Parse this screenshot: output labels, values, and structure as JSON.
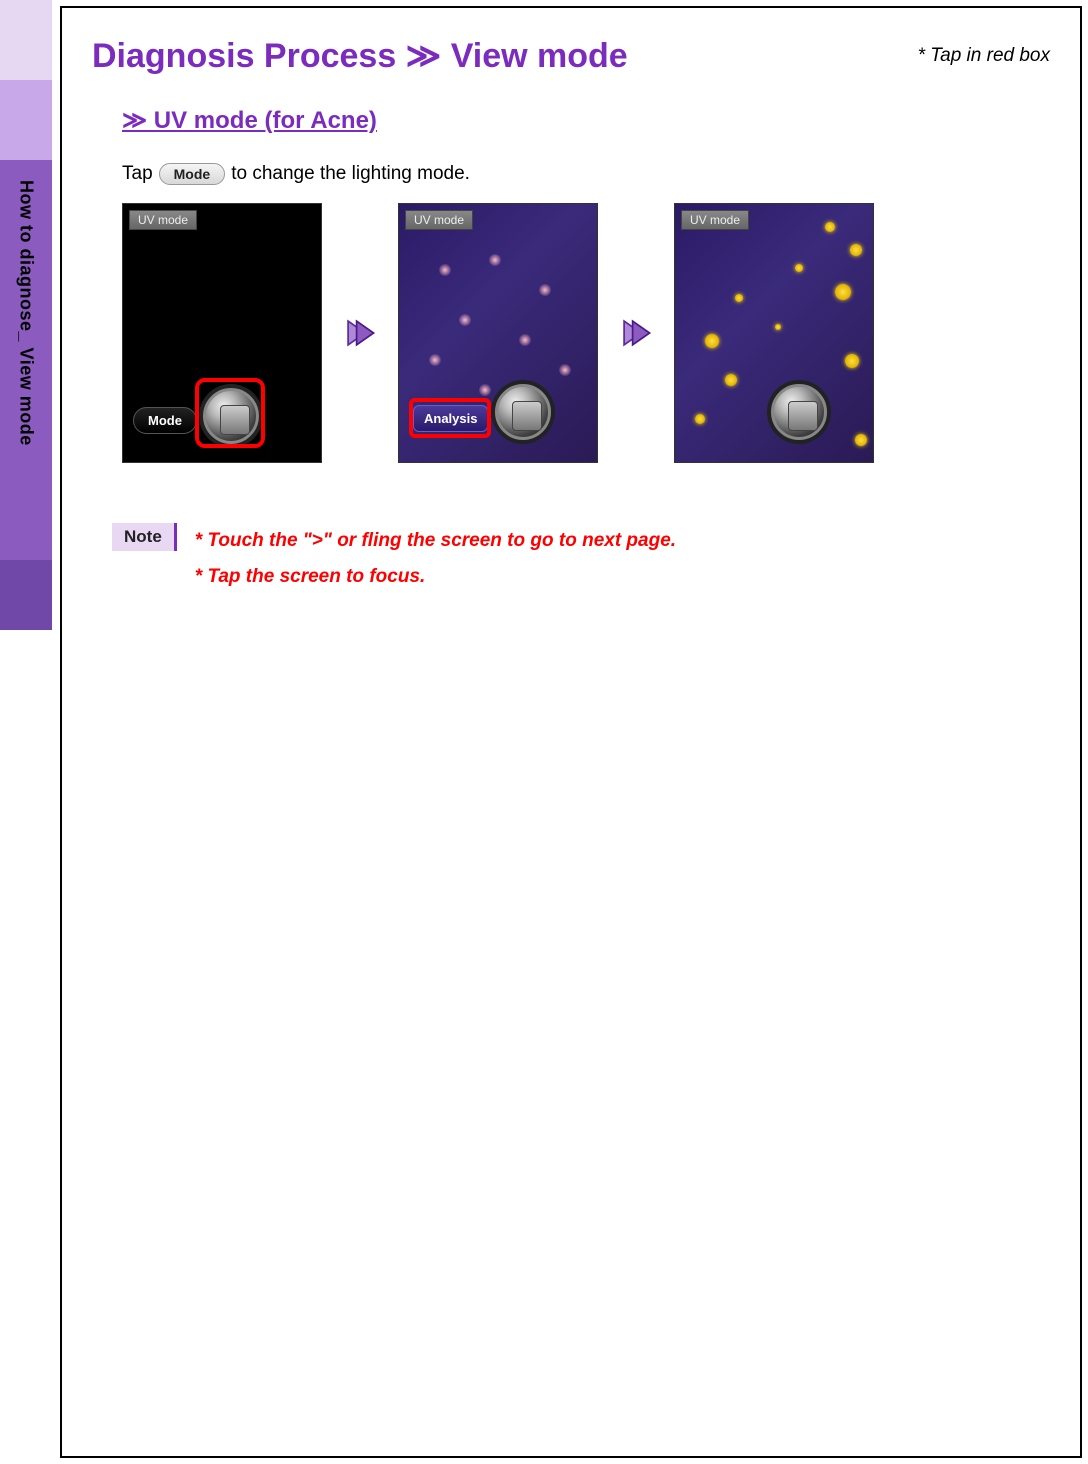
{
  "sidebar": {
    "active_label": "How to diagnose_ View mode"
  },
  "header": {
    "title": "Diagnosis Process ≫ View mode",
    "hint": "* Tap in red box"
  },
  "subtitle": "≫ UV mode (for Acne)",
  "instruction": {
    "pre": "Tap",
    "button_label": "Mode",
    "post": "to change the lighting mode."
  },
  "screens": {
    "uv_badge": "UV mode",
    "mode_label": "Mode",
    "analysis_label": "Analysis"
  },
  "note": {
    "label": "Note",
    "line1": "* Touch the \">\" or fling the screen to go to next page.",
    "line2": "* Tap the screen to focus."
  }
}
